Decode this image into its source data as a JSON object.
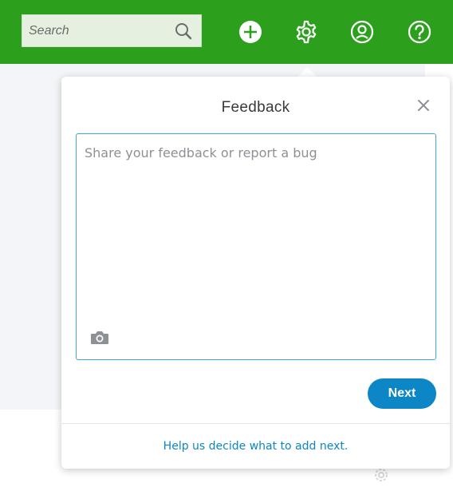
{
  "header": {
    "search": {
      "placeholder": "Search",
      "value": ""
    },
    "icons": [
      "search-icon",
      "plus-icon",
      "gear-icon",
      "user-icon",
      "help-icon"
    ],
    "brand_color": "#2ca01c"
  },
  "feedback_dialog": {
    "title": "Feedback",
    "textarea": {
      "placeholder": "Share your feedback or report a bug",
      "value": ""
    },
    "next_label": "Next",
    "help_link": "Help us decide what to add next.",
    "accent_color": "#0d86c6"
  }
}
